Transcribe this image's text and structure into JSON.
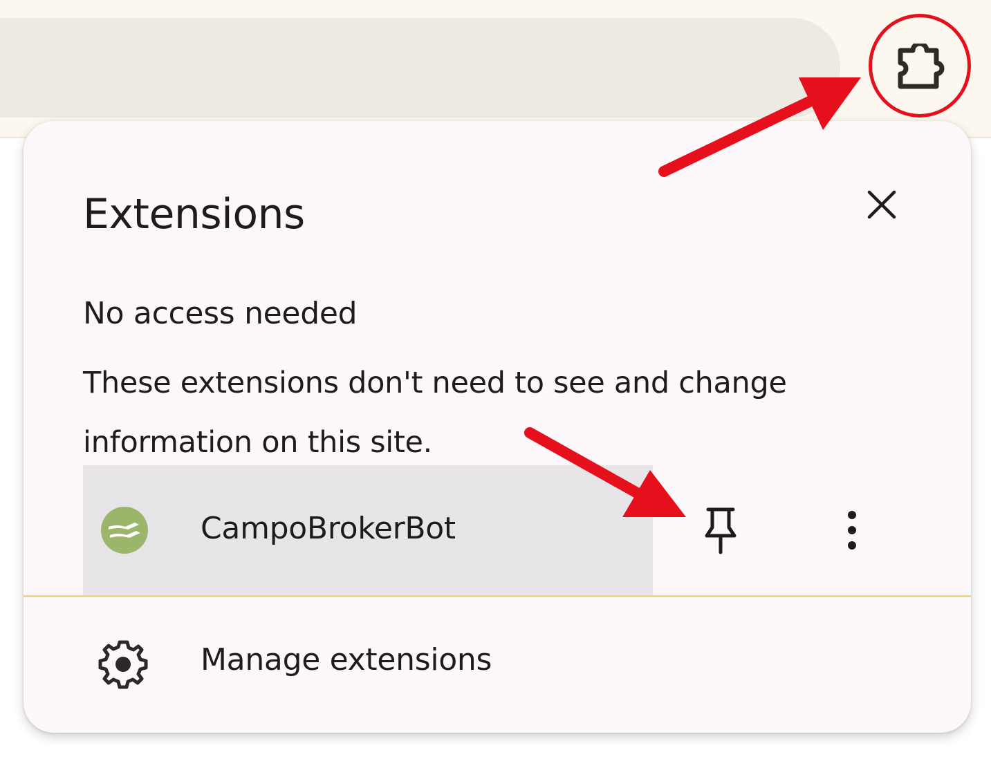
{
  "popup": {
    "title": "Extensions",
    "section_heading": "No access needed",
    "section_description": "These extensions don't need to see and change information on this site.",
    "extensions": [
      {
        "name": "CampoBrokerBot",
        "icon": "campobrokerbot-logo",
        "icon_color": "#9bb56b",
        "pin_icon": "pin-icon",
        "menu_icon": "more-vert-icon"
      }
    ],
    "footer": {
      "manage_label": "Manage extensions",
      "manage_icon": "gear-icon"
    },
    "close_icon": "close-icon"
  },
  "toolbar": {
    "extensions_button_icon": "puzzle-icon"
  },
  "annotations": {
    "highlight_color": "#e5101c",
    "items": [
      "arrow-to-extensions-button",
      "arrow-to-pin-button",
      "circle-around-extensions-button"
    ]
  },
  "colors": {
    "toolbar_bg": "#fcf8ef",
    "omnibox_bg": "#edeae3",
    "popup_bg": "#fbf7fa",
    "row_hover_bg": "#e8e5e8",
    "divider": "#f0d87a",
    "text": "#1d1b1d"
  }
}
